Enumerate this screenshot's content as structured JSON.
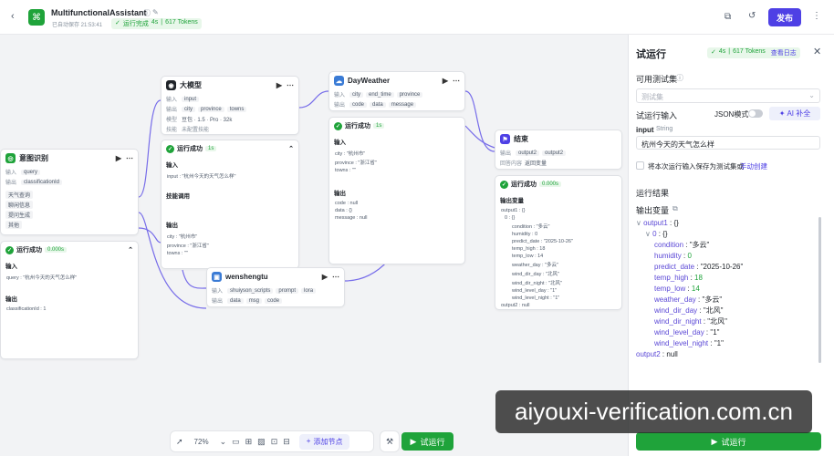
{
  "header": {
    "title": "MultifunctionalAssistant",
    "autosave": "已自动保存 21:53:41",
    "run_status": "运行完成",
    "run_time": "4s",
    "tokens": "617 Tokens",
    "publish_label": "发布"
  },
  "canvas": {
    "intent_node": {
      "title": "意图识别",
      "in_label": "输入",
      "in_var": "query",
      "out_label": "输出",
      "out_var": "classificationId",
      "opts": [
        "天气查询",
        "聊闲信息",
        "提问生成"
      ],
      "other": "其他",
      "run_label": "运行成功",
      "run_time": "0.000s",
      "input_label": "输入",
      "input_text": "query : \"杭州今天的天气怎么样\"",
      "output_label": "输出",
      "output_text": "classificationId : 1"
    },
    "llm_node": {
      "title": "大模型",
      "in_label": "输入",
      "in_var": "input",
      "out_label": "输出",
      "out_vars": [
        "city",
        "province",
        "towns"
      ],
      "model_label": "模型",
      "model_value": "豆包 · 1.5 · Pro · 32k",
      "skill_label": "技能",
      "skill_value": "未配置技能",
      "run_label": "运行成功",
      "run_time": "1s",
      "input_label": "输入",
      "input_text": "input : \"杭州今天的天气怎么样\"",
      "skill_call": "技能调用",
      "output_label": "输出",
      "output_lines": [
        "city : \"杭州市\"",
        "province : \"浙江省\"",
        "towns : \"\""
      ]
    },
    "weather_node": {
      "title": "DayWeather",
      "in_label": "输入",
      "in_vars": [
        "city",
        "end_time",
        "province"
      ],
      "out_label": "输出",
      "out_vars": [
        "code",
        "data",
        "message"
      ],
      "run_label": "运行成功",
      "run_time": "1s",
      "input_label": "输入",
      "input_lines": [
        "city : \"杭州市\"",
        "province : \"浙江省\"",
        "towns : \"\""
      ],
      "output_label": "输出",
      "output_lines": [
        "code : null",
        "data : {}",
        "message : null"
      ]
    },
    "end_node": {
      "title": "结束",
      "out_label": "输出",
      "out_vars": [
        "output2",
        "output2"
      ],
      "answer_label": "回答内容",
      "answer_value": "返回变量",
      "run_label": "运行成功",
      "run_time": "0.000s",
      "output_label": "输出变量",
      "output_lines": [
        "output1 : {}",
        "0 : {}",
        "condition : \"多云\"",
        "humidity : 0",
        "predict_date : \"2025-10-26\"",
        "temp_high : 18",
        "temp_low : 14",
        "weather_day : \"多云\"",
        "wind_dir_day : \"北风\"",
        "wind_dir_night : \"北风\"",
        "wind_level_day : \"1\"",
        "wind_level_night : \"1\"",
        "output2 : null"
      ]
    },
    "wsheng_node": {
      "title": "wenshengtu",
      "in_label": "输入",
      "in_vars": [
        "shuiyson_scripts",
        "prompt",
        "lora"
      ],
      "out_label": "输出",
      "out_vars": [
        "data",
        "msg",
        "code"
      ]
    }
  },
  "toolbar": {
    "zoom": "72%",
    "add_node": "添加节点",
    "run": "试运行"
  },
  "panel": {
    "title": "试运行",
    "status_time": "4s",
    "status_tokens": "617 Tokens",
    "view_log": "查看日志",
    "testset_label": "可用测试集",
    "testset_placeholder": "测试集",
    "input_label": "试运行输入",
    "json_mode": "JSON模式",
    "ai_fill": "AI 补全",
    "var_name": "input",
    "var_type": "String",
    "var_value": "杭州今天的天气怎么样",
    "save_text": "将本次运行输入保存为测试集或",
    "save_link": "手动创建",
    "result_label": "运行结果",
    "out_var_label": "输出变量",
    "run_button": "试运行",
    "tree": [
      {
        "key": "output1",
        "val": "{}",
        "depth": 0,
        "arrow": "∨"
      },
      {
        "key": "0",
        "val": "{}",
        "depth": 1,
        "arrow": "∨"
      },
      {
        "key": "condition",
        "val": "\"多云\"",
        "depth": 2
      },
      {
        "key": "humidity",
        "val": "0",
        "depth": 2,
        "num": true
      },
      {
        "key": "predict_date",
        "val": "\"2025-10-26\"",
        "depth": 2
      },
      {
        "key": "temp_high",
        "val": "18",
        "depth": 2,
        "num": true
      },
      {
        "key": "temp_low",
        "val": "14",
        "depth": 2,
        "num": true
      },
      {
        "key": "weather_day",
        "val": "\"多云\"",
        "depth": 2
      },
      {
        "key": "wind_dir_day",
        "val": "\"北风\"",
        "depth": 2
      },
      {
        "key": "wind_dir_night",
        "val": "\"北风\"",
        "depth": 2
      },
      {
        "key": "wind_level_day",
        "val": "\"1\"",
        "depth": 2
      },
      {
        "key": "wind_level_night",
        "val": "\"1\"",
        "depth": 2
      },
      {
        "key": "output2",
        "val": "null",
        "depth": 0
      }
    ]
  },
  "watermark": "aiyouxi-verification.com.cn",
  "colors": {
    "accent": "#4e40e5",
    "success": "#1fa33a",
    "run_green": "#1fa33a"
  }
}
